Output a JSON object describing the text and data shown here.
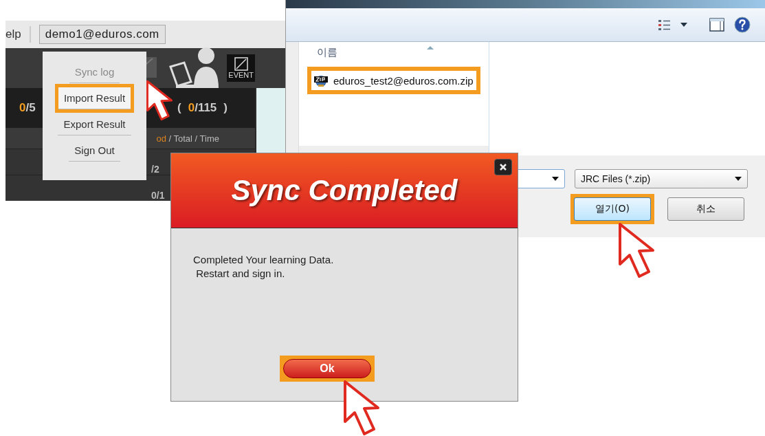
{
  "app_window": {
    "menu_label": "elp",
    "account": "demo1@eduros.com",
    "toolbar_label": "EVENT",
    "stats": [
      {
        "done": "0",
        "total": "/5"
      },
      {
        "done": "0",
        "total": "/115",
        "open": "(",
        "close": ")"
      }
    ],
    "legend_accent": "od",
    "legend": "/ Total / Time",
    "row_values": [
      "/2",
      "0/1"
    ],
    "menu": [
      {
        "label": "Sync log",
        "disabled": true,
        "highlighted": false
      },
      {
        "label": "Import Result",
        "disabled": false,
        "highlighted": true
      },
      {
        "label": "Export Result",
        "disabled": false,
        "highlighted": false
      },
      {
        "label": "Sign Out",
        "disabled": false,
        "highlighted": false
      }
    ]
  },
  "file_dialog": {
    "column_header": "이름",
    "files": [
      {
        "name": "eduros_test2@eduros.com.zip",
        "highlighted": true
      }
    ],
    "file_type": "JRC Files (*.zip)",
    "buttons": [
      {
        "label": "열기(O)",
        "highlighted": true
      },
      {
        "label": "취소",
        "highlighted": false
      }
    ]
  },
  "sync_dialog": {
    "title": "Sync Completed",
    "message": [
      "Completed Your learning Data.",
      " Restart and sign in."
    ],
    "button": {
      "label": "Ok",
      "highlighted": true
    }
  }
}
